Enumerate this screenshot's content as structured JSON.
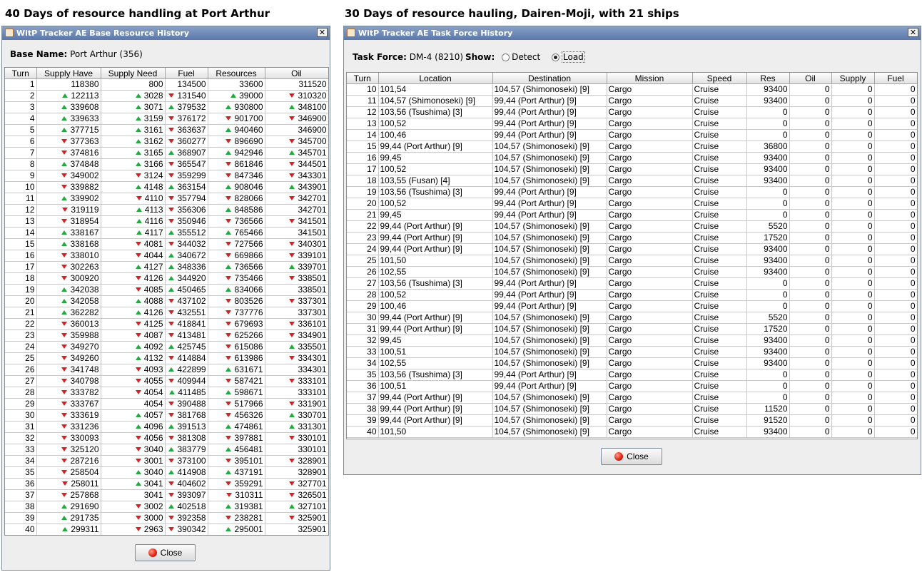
{
  "captions": {
    "left": "40 Days of resource handling at Port Arthur",
    "right": "30 Days of resource hauling, Dairen-Moji, with 21 ships"
  },
  "base_window": {
    "title": "WitP Tracker AE Base Resource History",
    "base_name_label": "Base Name:",
    "base_name_value": "Port Arthur (356)",
    "columns": [
      "Turn",
      "Supply Have",
      "Supply Need",
      "Fuel",
      "Resources",
      "Oil"
    ],
    "rows": [
      [
        "1",
        "118380",
        "800",
        "134500",
        "33600",
        "311520"
      ],
      [
        "2",
        "u122113",
        "u3028",
        "d131540",
        "u39000",
        "d310320"
      ],
      [
        "3",
        "u339608",
        "u3071",
        "u379532",
        "u930800",
        "u348100"
      ],
      [
        "4",
        "u339633",
        "u3159",
        "d376172",
        "d901700",
        "d346900"
      ],
      [
        "5",
        "u377715",
        "u3161",
        "d363637",
        "u940460",
        "346900"
      ],
      [
        "6",
        "d377363",
        "u3162",
        "d360277",
        "d896690",
        "d345700"
      ],
      [
        "7",
        "d374816",
        "u3165",
        "u368907",
        "u942946",
        "u345701"
      ],
      [
        "8",
        "u374848",
        "u3166",
        "d365547",
        "d861846",
        "d344501"
      ],
      [
        "9",
        "d349002",
        "d3124",
        "d359299",
        "d847346",
        "d343301"
      ],
      [
        "10",
        "d339882",
        "u4148",
        "u363154",
        "u908046",
        "u343901"
      ],
      [
        "11",
        "u339902",
        "d4110",
        "d357794",
        "d828066",
        "d342701"
      ],
      [
        "12",
        "d319119",
        "u4113",
        "d356306",
        "u848586",
        "342701"
      ],
      [
        "13",
        "d318954",
        "u4116",
        "d350946",
        "d736566",
        "d341501"
      ],
      [
        "14",
        "u338167",
        "u4117",
        "u355512",
        "u765466",
        "341501"
      ],
      [
        "15",
        "u338168",
        "d4081",
        "d344032",
        "d727566",
        "d340301"
      ],
      [
        "16",
        "d338010",
        "d4044",
        "u340672",
        "d669866",
        "d339101"
      ],
      [
        "17",
        "d302263",
        "u4127",
        "u348336",
        "u736566",
        "u339701"
      ],
      [
        "18",
        "d300920",
        "d4126",
        "u344920",
        "d735466",
        "d338501"
      ],
      [
        "19",
        "u342038",
        "d4085",
        "u450465",
        "u834066",
        "338501"
      ],
      [
        "20",
        "u342058",
        "u4088",
        "d437102",
        "d803526",
        "d337301"
      ],
      [
        "21",
        "u362282",
        "u4126",
        "d432551",
        "d737776",
        "337301"
      ],
      [
        "22",
        "d360013",
        "d4125",
        "d418841",
        "d679693",
        "d336101"
      ],
      [
        "23",
        "d359988",
        "d4087",
        "d413481",
        "d625266",
        "d334901"
      ],
      [
        "24",
        "d349270",
        "u4092",
        "u425745",
        "d615086",
        "u335501"
      ],
      [
        "25",
        "d349260",
        "u4132",
        "d414884",
        "d613986",
        "d334301"
      ],
      [
        "26",
        "d341748",
        "d4093",
        "u422899",
        "u631671",
        "334301"
      ],
      [
        "27",
        "d340798",
        "d4055",
        "d409944",
        "d587421",
        "d333101"
      ],
      [
        "28",
        "d333782",
        "d4054",
        "u411485",
        "u598671",
        "333101"
      ],
      [
        "29",
        "d333767",
        "4054",
        "d390488",
        "d517966",
        "d331901"
      ],
      [
        "30",
        "d333619",
        "u4057",
        "d381768",
        "d456326",
        "u330701"
      ],
      [
        "31",
        "d331236",
        "u4096",
        "u391513",
        "u474861",
        "u331301"
      ],
      [
        "32",
        "d330093",
        "d4056",
        "d381308",
        "d397881",
        "d330101"
      ],
      [
        "33",
        "d325120",
        "d3040",
        "u383779",
        "u456481",
        "330101"
      ],
      [
        "34",
        "d287216",
        "d3001",
        "d373100",
        "d395101",
        "d328901"
      ],
      [
        "35",
        "d258504",
        "u3040",
        "u414908",
        "u437191",
        "328901"
      ],
      [
        "36",
        "d258011",
        "u3041",
        "d404602",
        "d359291",
        "d327701"
      ],
      [
        "37",
        "d257868",
        "3041",
        "d393097",
        "d310311",
        "d326501"
      ],
      [
        "38",
        "u291690",
        "d3002",
        "u402518",
        "u319381",
        "u327101"
      ],
      [
        "39",
        "u291735",
        "d3000",
        "d392358",
        "d238281",
        "d325901"
      ],
      [
        "40",
        "u299311",
        "d2963",
        "d390342",
        "u295001",
        "325901"
      ]
    ],
    "close_label": "Close"
  },
  "tf_window": {
    "title": "WitP Tracker AE Task Force History",
    "tf_label": "Task Force:",
    "tf_value": "DM-4 (8210)",
    "show_label": "Show:",
    "detect_label": "Detect",
    "load_label": "Load",
    "selected": "Load",
    "columns": [
      "Turn",
      "Location",
      "Destination",
      "Mission",
      "Speed",
      "Res",
      "Oil",
      "Supply",
      "Fuel"
    ],
    "rows": [
      [
        "10",
        "101,54",
        "104,57 (Shimonoseki) [9]",
        "Cargo",
        "Cruise",
        "93400",
        "0",
        "0",
        "0"
      ],
      [
        "11",
        "104,57 (Shimonoseki) [9]",
        "99,44 (Port Arthur) [9]",
        "Cargo",
        "Cruise",
        "93400",
        "0",
        "0",
        "0"
      ],
      [
        "12",
        "103,56 (Tsushima) [3]",
        "99,44 (Port Arthur) [9]",
        "Cargo",
        "Cruise",
        "0",
        "0",
        "0",
        "0"
      ],
      [
        "13",
        "100,52",
        "99,44 (Port Arthur) [9]",
        "Cargo",
        "Cruise",
        "0",
        "0",
        "0",
        "0"
      ],
      [
        "14",
        "100,46",
        "99,44 (Port Arthur) [9]",
        "Cargo",
        "Cruise",
        "0",
        "0",
        "0",
        "0"
      ],
      [
        "15",
        "99,44 (Port Arthur) [9]",
        "104,57 (Shimonoseki) [9]",
        "Cargo",
        "Cruise",
        "36800",
        "0",
        "0",
        "0"
      ],
      [
        "16",
        "99,45",
        "104,57 (Shimonoseki) [9]",
        "Cargo",
        "Cruise",
        "93400",
        "0",
        "0",
        "0"
      ],
      [
        "17",
        "100,52",
        "104,57 (Shimonoseki) [9]",
        "Cargo",
        "Cruise",
        "93400",
        "0",
        "0",
        "0"
      ],
      [
        "18",
        "103,55 (Fusan) [4]",
        "104,57 (Shimonoseki) [9]",
        "Cargo",
        "Cruise",
        "93400",
        "0",
        "0",
        "0"
      ],
      [
        "19",
        "103,56 (Tsushima) [3]",
        "99,44 (Port Arthur) [9]",
        "Cargo",
        "Cruise",
        "0",
        "0",
        "0",
        "0"
      ],
      [
        "20",
        "100,52",
        "99,44 (Port Arthur) [9]",
        "Cargo",
        "Cruise",
        "0",
        "0",
        "0",
        "0"
      ],
      [
        "21",
        "99,45",
        "99,44 (Port Arthur) [9]",
        "Cargo",
        "Cruise",
        "0",
        "0",
        "0",
        "0"
      ],
      [
        "22",
        "99,44 (Port Arthur) [9]",
        "104,57 (Shimonoseki) [9]",
        "Cargo",
        "Cruise",
        "5520",
        "0",
        "0",
        "0"
      ],
      [
        "23",
        "99,44 (Port Arthur) [9]",
        "104,57 (Shimonoseki) [9]",
        "Cargo",
        "Cruise",
        "17520",
        "0",
        "0",
        "0"
      ],
      [
        "24",
        "99,44 (Port Arthur) [9]",
        "104,57 (Shimonoseki) [9]",
        "Cargo",
        "Cruise",
        "93400",
        "0",
        "0",
        "0"
      ],
      [
        "25",
        "101,50",
        "104,57 (Shimonoseki) [9]",
        "Cargo",
        "Cruise",
        "93400",
        "0",
        "0",
        "0"
      ],
      [
        "26",
        "102,55",
        "104,57 (Shimonoseki) [9]",
        "Cargo",
        "Cruise",
        "93400",
        "0",
        "0",
        "0"
      ],
      [
        "27",
        "103,56 (Tsushima) [3]",
        "99,44 (Port Arthur) [9]",
        "Cargo",
        "Cruise",
        "0",
        "0",
        "0",
        "0"
      ],
      [
        "28",
        "100,52",
        "99,44 (Port Arthur) [9]",
        "Cargo",
        "Cruise",
        "0",
        "0",
        "0",
        "0"
      ],
      [
        "29",
        "100,46",
        "99,44 (Port Arthur) [9]",
        "Cargo",
        "Cruise",
        "0",
        "0",
        "0",
        "0"
      ],
      [
        "30",
        "99,44 (Port Arthur) [9]",
        "104,57 (Shimonoseki) [9]",
        "Cargo",
        "Cruise",
        "5520",
        "0",
        "0",
        "0"
      ],
      [
        "31",
        "99,44 (Port Arthur) [9]",
        "104,57 (Shimonoseki) [9]",
        "Cargo",
        "Cruise",
        "17520",
        "0",
        "0",
        "0"
      ],
      [
        "32",
        "99,45",
        "104,57 (Shimonoseki) [9]",
        "Cargo",
        "Cruise",
        "93400",
        "0",
        "0",
        "0"
      ],
      [
        "33",
        "100,51",
        "104,57 (Shimonoseki) [9]",
        "Cargo",
        "Cruise",
        "93400",
        "0",
        "0",
        "0"
      ],
      [
        "34",
        "102,55",
        "104,57 (Shimonoseki) [9]",
        "Cargo",
        "Cruise",
        "93400",
        "0",
        "0",
        "0"
      ],
      [
        "35",
        "103,56 (Tsushima) [3]",
        "99,44 (Port Arthur) [9]",
        "Cargo",
        "Cruise",
        "0",
        "0",
        "0",
        "0"
      ],
      [
        "36",
        "100,51",
        "99,44 (Port Arthur) [9]",
        "Cargo",
        "Cruise",
        "0",
        "0",
        "0",
        "0"
      ],
      [
        "37",
        "99,44 (Port Arthur) [9]",
        "104,57 (Shimonoseki) [9]",
        "Cargo",
        "Cruise",
        "0",
        "0",
        "0",
        "0"
      ],
      [
        "38",
        "99,44 (Port Arthur) [9]",
        "104,57 (Shimonoseki) [9]",
        "Cargo",
        "Cruise",
        "11520",
        "0",
        "0",
        "0"
      ],
      [
        "39",
        "99,44 (Port Arthur) [9]",
        "104,57 (Shimonoseki) [9]",
        "Cargo",
        "Cruise",
        "91520",
        "0",
        "0",
        "0"
      ],
      [
        "40",
        "101,50",
        "104,57 (Shimonoseki) [9]",
        "Cargo",
        "Cruise",
        "93400",
        "0",
        "0",
        "0"
      ]
    ],
    "close_label": "Close"
  },
  "colors": {
    "up_arrow": "#1eaa3c",
    "down_arrow": "#d82020",
    "titlebar": "#5a78ab"
  },
  "legend": {
    "u": "green-up-arrow",
    "d": "red-down-arrow"
  }
}
